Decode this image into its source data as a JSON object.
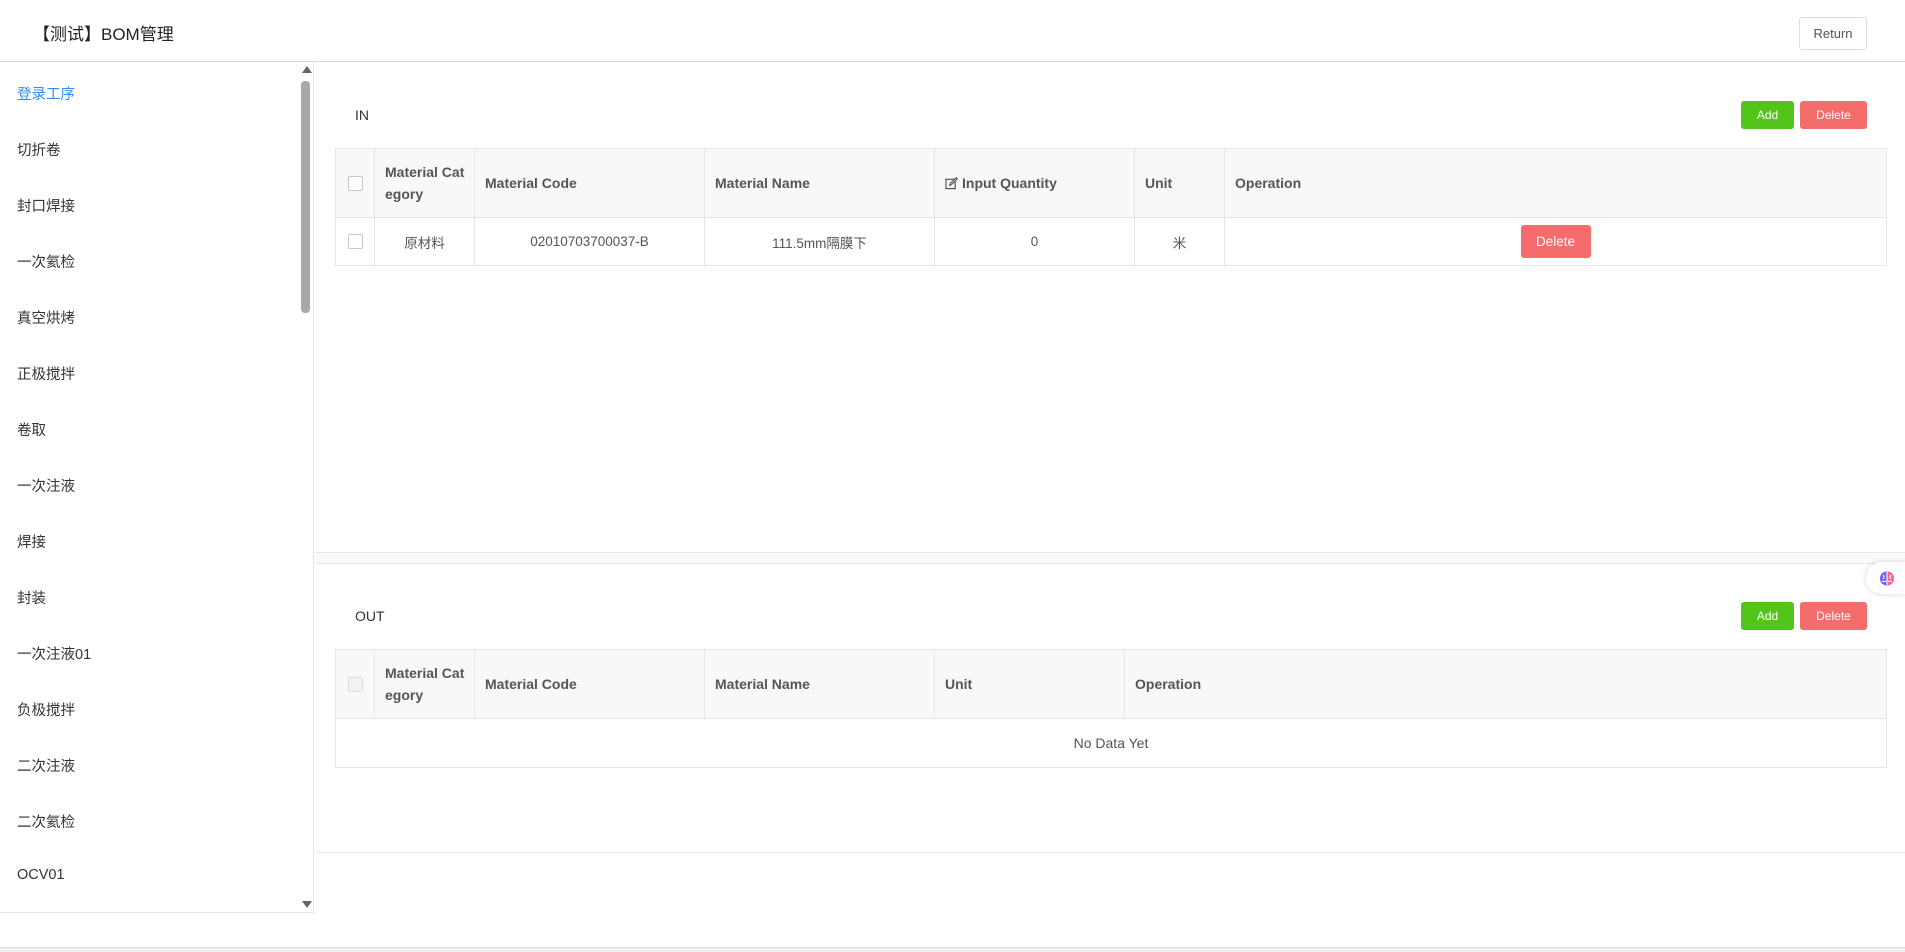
{
  "header": {
    "title": "【测试】BOM管理",
    "return_label": "Return"
  },
  "sidebar": {
    "active_index": 0,
    "items": [
      {
        "label": "登录工序"
      },
      {
        "label": "切折卷"
      },
      {
        "label": "封口焊接"
      },
      {
        "label": "一次氦检"
      },
      {
        "label": "真空烘烤"
      },
      {
        "label": "正极搅拌"
      },
      {
        "label": "卷取"
      },
      {
        "label": "一次注液"
      },
      {
        "label": "焊接"
      },
      {
        "label": "封装"
      },
      {
        "label": "一次注液01"
      },
      {
        "label": "负极搅拌"
      },
      {
        "label": "二次注液"
      },
      {
        "label": "二次氦检"
      },
      {
        "label": "OCV01"
      }
    ]
  },
  "in_section": {
    "title": "IN",
    "add_label": "Add",
    "delete_label": "Delete",
    "columns": {
      "category": "Material Category",
      "code": "Material Code",
      "name": "Material Name",
      "quantity": "Input Quantity",
      "unit": "Unit",
      "operation": "Operation"
    },
    "rows": [
      {
        "category": "原材料",
        "code": "02010703700037-B",
        "name": "111.5mm隔膜下",
        "quantity": "0",
        "unit": "米",
        "delete_label": "Delete"
      }
    ]
  },
  "out_section": {
    "title": "OUT",
    "add_label": "Add",
    "delete_label": "Delete",
    "columns": {
      "category": "Material Category",
      "code": "Material Code",
      "name": "Material Name",
      "unit": "Unit",
      "operation": "Operation"
    },
    "empty_text": "No Data Yet"
  },
  "colors": {
    "accent": "#2f8ff1",
    "add": "#52c41a",
    "delete": "#f56c6c"
  },
  "icons": {
    "edit": "edit-icon",
    "floating": "brain-icon"
  }
}
